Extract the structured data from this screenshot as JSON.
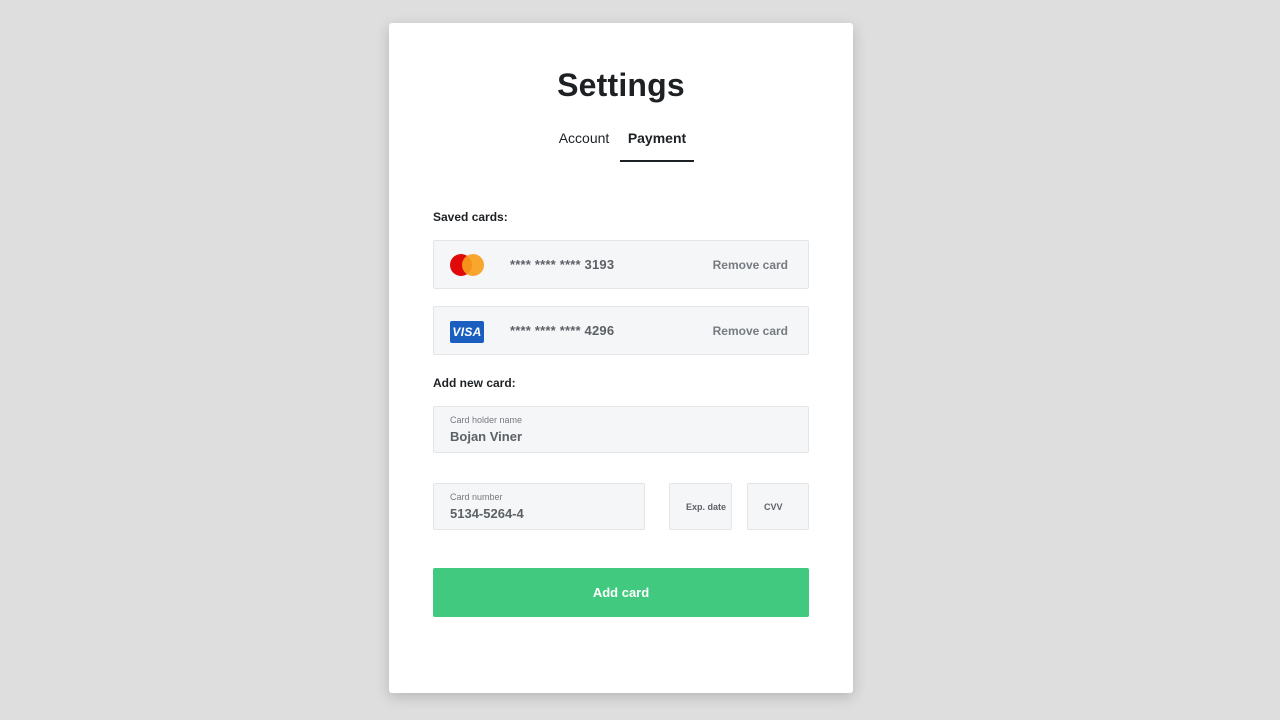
{
  "page": {
    "title": "Settings"
  },
  "tabs": [
    {
      "label": "Account",
      "active": false
    },
    {
      "label": "Payment",
      "active": true
    }
  ],
  "saved_cards": {
    "label": "Saved cards:",
    "cards": [
      {
        "brand_icon": "mastercard-icon",
        "number": "**** **** **** 3193",
        "action": "Remove card"
      },
      {
        "brand_icon": "visa-icon",
        "brand_text": "VISA",
        "number": "**** **** **** 4296",
        "action": "Remove card"
      }
    ]
  },
  "new_card": {
    "label": "Add new card:",
    "holder": {
      "label": "Card holder name",
      "value": "Bojan Viner"
    },
    "number": {
      "label": "Card number",
      "value": "5134-5264-4"
    },
    "exp": {
      "placeholder": "Exp. date"
    },
    "cvv": {
      "placeholder": "CVV"
    },
    "submit_label": "Add card"
  },
  "colors": {
    "background": "#dedede",
    "accent_button": "#41c97f",
    "visa_blue": "#1a5fc0",
    "mastercard_red": "#e10a0a",
    "mastercard_orange": "#f79e1b"
  }
}
